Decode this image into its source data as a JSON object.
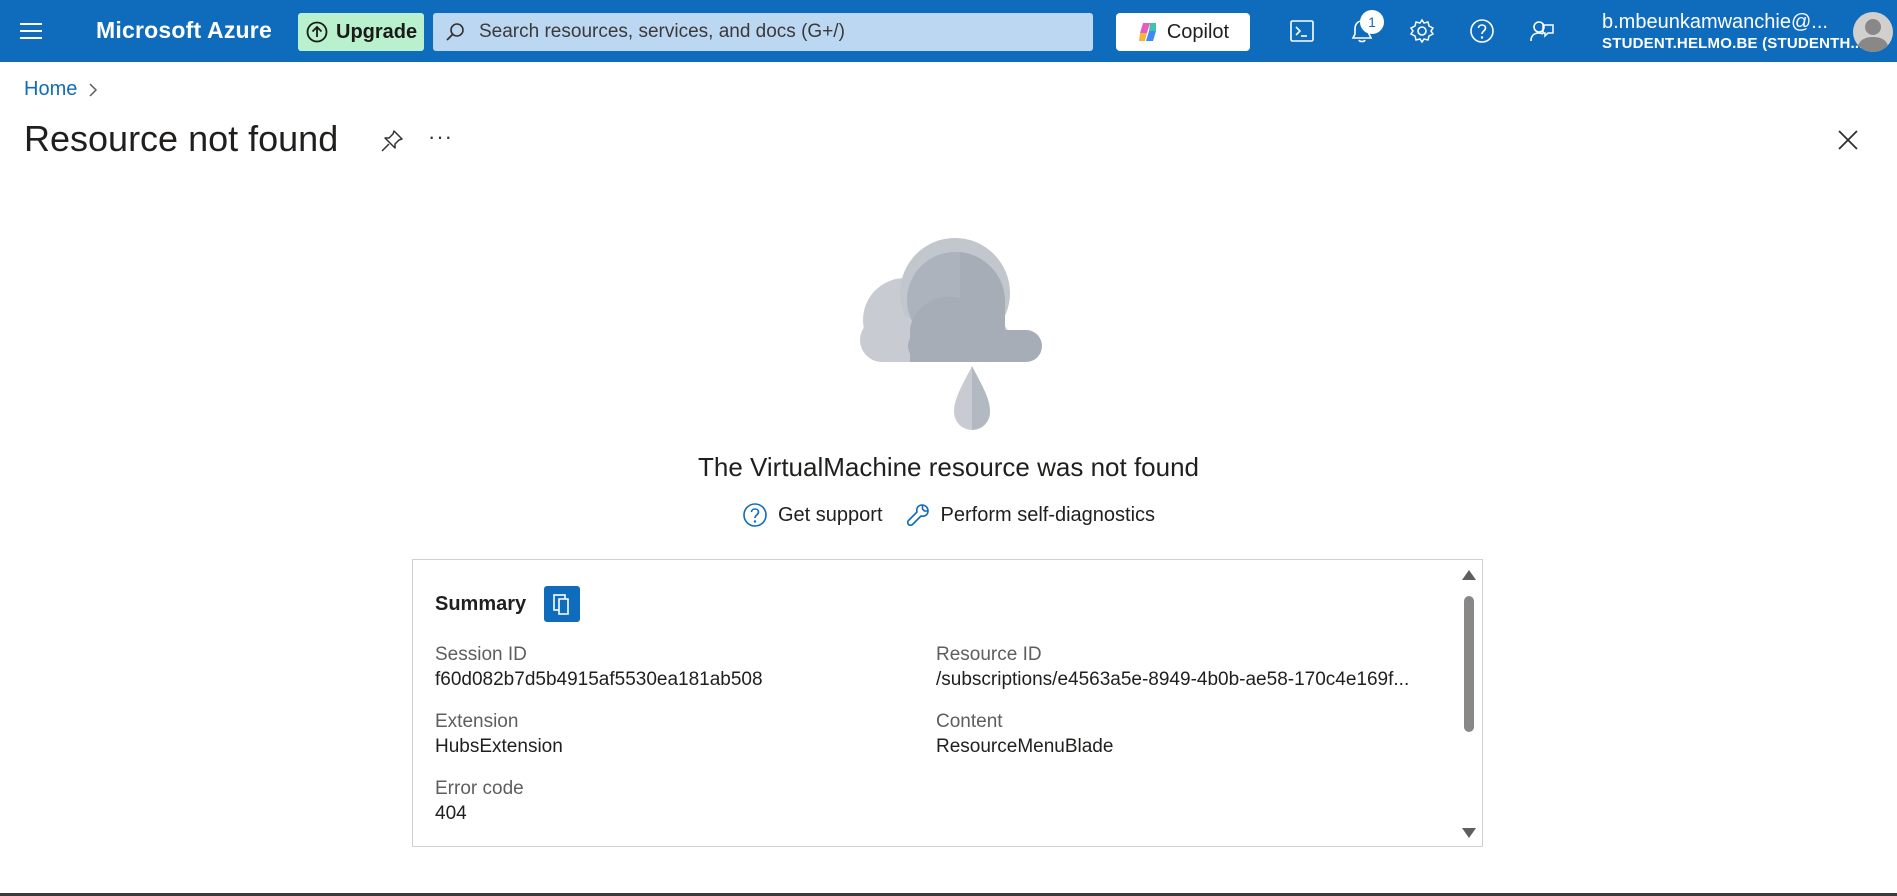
{
  "topbar": {
    "brand": "Microsoft Azure",
    "upgrade_label": "Upgrade",
    "search_placeholder": "Search resources, services, and docs (G+/)",
    "copilot_label": "Copilot",
    "notification_count": "1",
    "user_name": "b.mbeunkamwanchie@...",
    "user_directory": "STUDENT.HELMO.BE (STUDENTH...",
    "icons": [
      "menu-icon",
      "upgrade-icon",
      "search-icon",
      "copilot-icon",
      "cloud-shell-icon",
      "notifications-icon",
      "settings-icon",
      "help-icon",
      "feedback-icon",
      "avatar"
    ]
  },
  "breadcrumb": {
    "home": "Home"
  },
  "header": {
    "title": "Resource not found",
    "more": "···"
  },
  "empty_state": {
    "message": "The VirtualMachine resource was not found",
    "get_support": "Get support",
    "self_diagnostics": "Perform self-diagnostics"
  },
  "summary": {
    "title": "Summary",
    "session_id_label": "Session ID",
    "session_id": "f60d082b7d5b4915af5530ea181ab508",
    "resource_id_label": "Resource ID",
    "resource_id": "/subscriptions/e4563a5e-8949-4b0b-ae58-170c4e169f...",
    "extension_label": "Extension",
    "extension": "HubsExtension",
    "content_label": "Content",
    "content": "ResourceMenuBlade",
    "error_code_label": "Error code",
    "error_code": "404"
  },
  "colors": {
    "accent": "#0f6cbd",
    "upgrade_bg": "#b9f1ce",
    "search_bg": "#bcd7f2"
  }
}
